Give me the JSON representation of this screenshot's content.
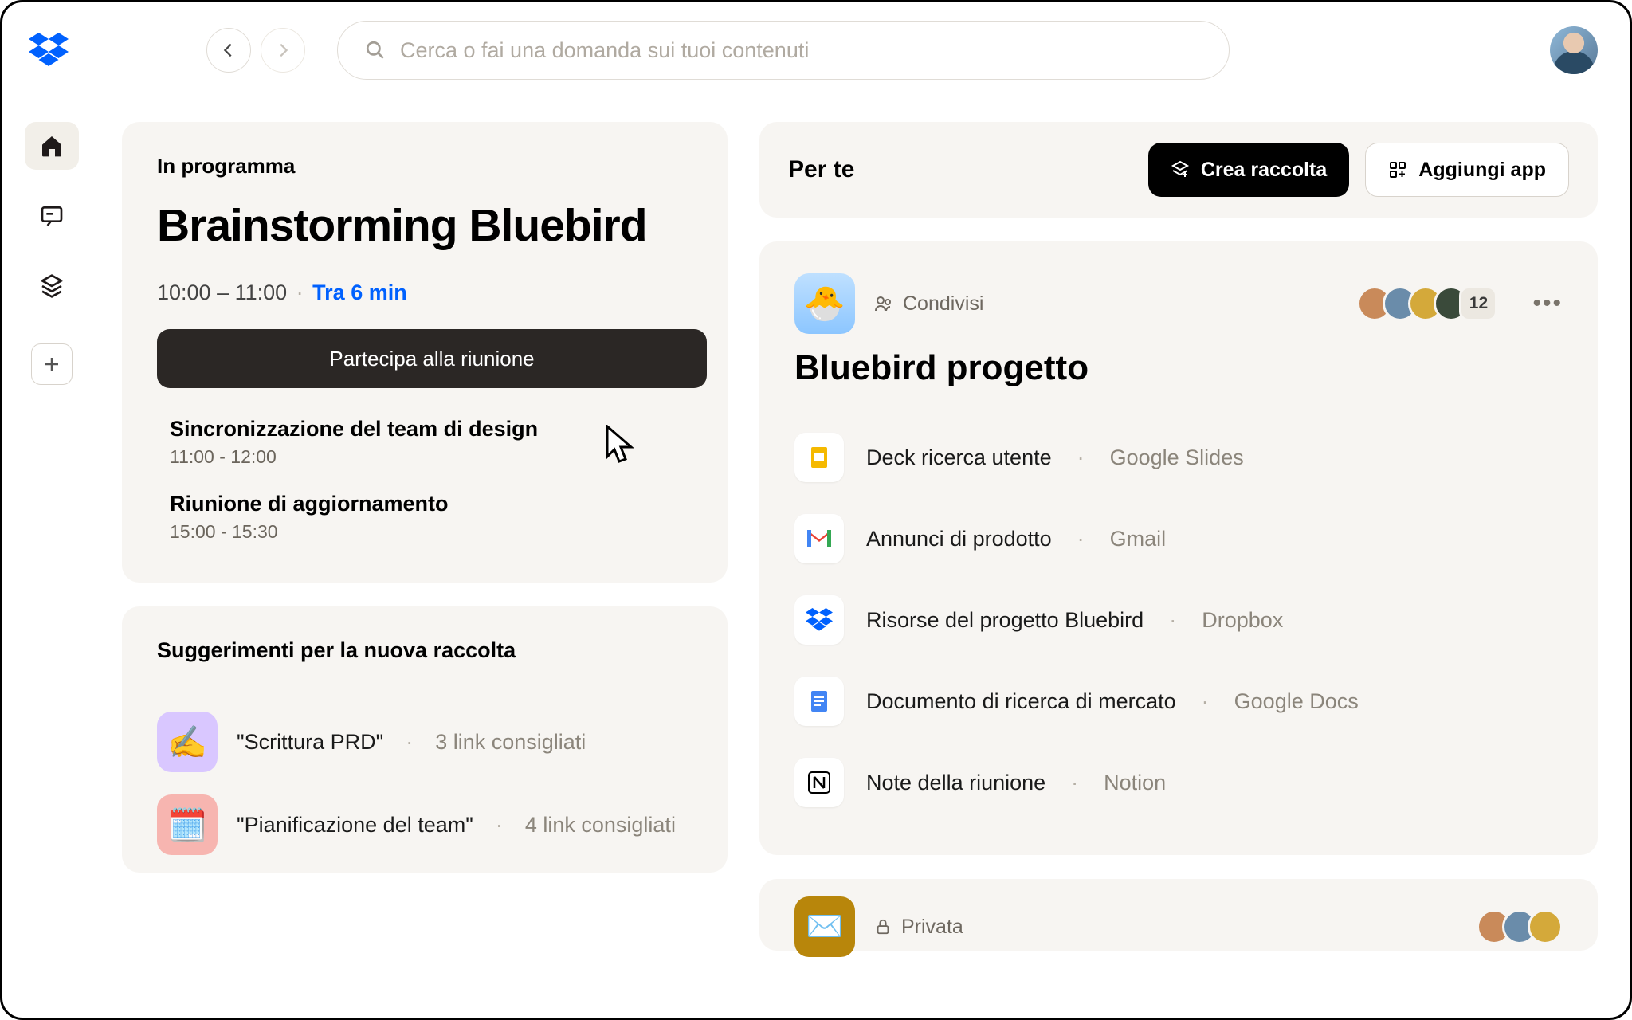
{
  "search": {
    "placeholder": "Cerca o fai una domanda sui tuoi contenuti"
  },
  "upcoming": {
    "label": "In programma",
    "title": "Brainstorming Bluebird",
    "time": "10:00 – 11:00",
    "countdown": "Tra 6 min",
    "join_label": "Partecipa alla riunione",
    "next": [
      {
        "title": "Sincronizzazione del team di design",
        "time": "11:00 - 12:00"
      },
      {
        "title": "Riunione di aggiornamento",
        "time": "15:00 - 15:30"
      }
    ]
  },
  "suggestions": {
    "heading": "Suggerimenti per la nuova raccolta",
    "items": [
      {
        "emoji": "✍️",
        "name": "\"Scrittura PRD\"",
        "meta": "3 link consigliati",
        "color": "purple"
      },
      {
        "emoji": "🗓️",
        "name": "\"Pianificazione del team\"",
        "meta": "4 link consigliati",
        "color": "red"
      }
    ]
  },
  "forYou": {
    "heading": "Per te",
    "create_label": "Crea raccolta",
    "add_app_label": "Aggiungi app"
  },
  "project": {
    "shared_label": "Condivisi",
    "avatar_extra": "12",
    "title": "Bluebird progetto",
    "emoji": "🐣",
    "files": [
      {
        "name": "Deck ricerca utente",
        "source": "Google Slides",
        "icon": "slides"
      },
      {
        "name": "Annunci di prodotto",
        "source": "Gmail",
        "icon": "gmail"
      },
      {
        "name": "Risorse del progetto Bluebird",
        "source": "Dropbox",
        "icon": "dropbox"
      },
      {
        "name": "Documento di ricerca di mercato",
        "source": "Google Docs",
        "icon": "docs"
      },
      {
        "name": "Note della riunione",
        "source": "Notion",
        "icon": "notion"
      }
    ]
  },
  "project2": {
    "shared_label": "Privata",
    "emoji": "✉️"
  }
}
